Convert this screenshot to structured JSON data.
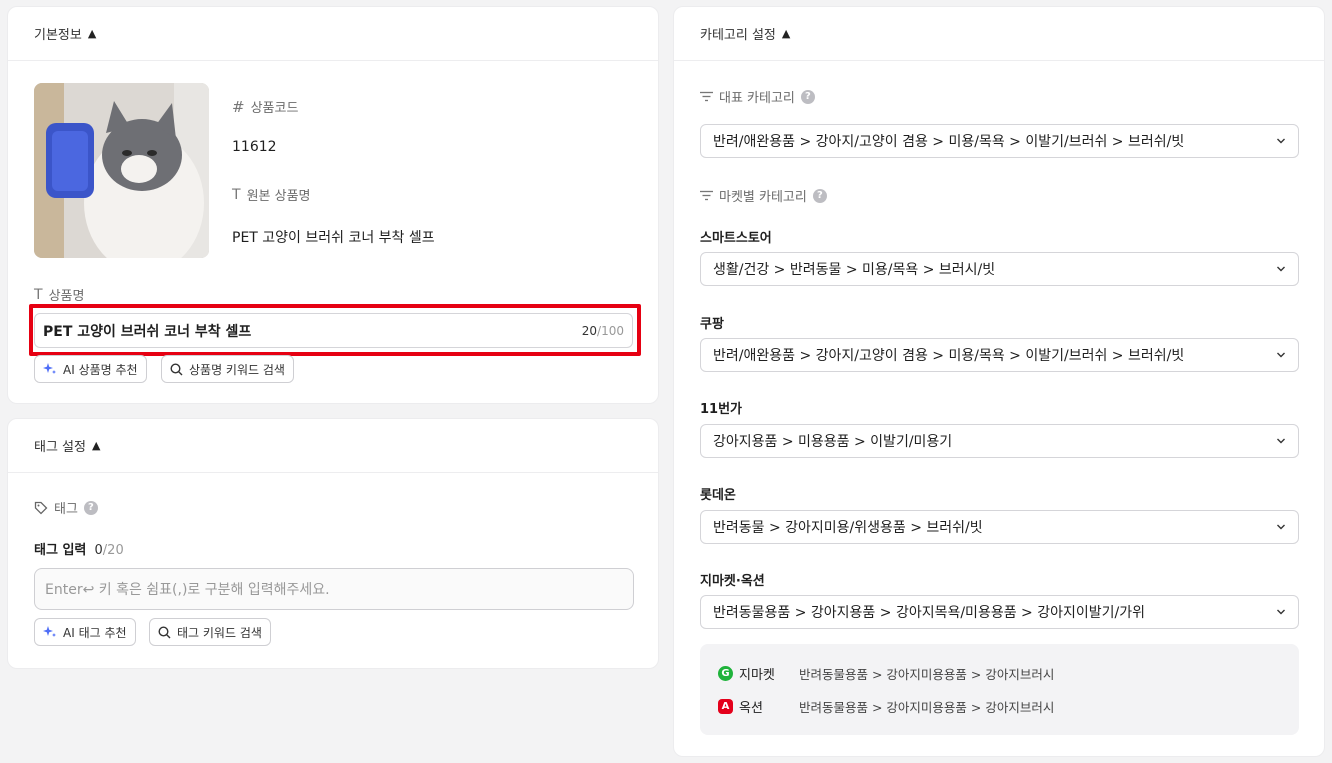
{
  "basic": {
    "title": "기본정보",
    "product_code_label": "상품코드",
    "product_code": "11612",
    "original_name_label": "원본 상품명",
    "original_name": "PET 고양이 브러쉬 코너 부착 셀프",
    "name_label": "상품명",
    "name_value": "PET 고양이 브러쉬 코너 부착 셀프",
    "name_count": "20",
    "name_max": "/100",
    "ai_name_button": "AI 상품명 추천",
    "keyword_search_button": "상품명 키워드 검색"
  },
  "tags": {
    "title": "태그 설정",
    "tag_label": "태그",
    "input_label": "태그 입력",
    "input_count": "0",
    "input_max": "/20",
    "input_placeholder": "Enter↩ 키 혹은 쉼표(,)로 구분해 입력해주세요.",
    "ai_tag_button": "AI 태그 추천",
    "tag_keyword_button": "태그 키워드 검색"
  },
  "category": {
    "title": "카테고리 설정",
    "main_label": "대표 카테고리",
    "main_value": "반려/애완용품 > 강아지/고양이 겸용 > 미용/목욕 > 이발기/브러쉬 > 브러쉬/빗",
    "market_label": "마켓별 카테고리",
    "markets": [
      {
        "name": "스마트스토어",
        "value": "생활/건강 > 반려동물 > 미용/목욕 > 브러시/빗"
      },
      {
        "name": "쿠팡",
        "value": "반려/애완용품 > 강아지/고양이 겸용 > 미용/목욕 > 이발기/브러쉬 > 브러쉬/빗"
      },
      {
        "name": "11번가",
        "value": "강아지용품 > 미용용품 > 이발기/미용기"
      },
      {
        "name": "롯데온",
        "value": "반려동물 > 강아지미용/위생용품 > 브러쉬/빗"
      },
      {
        "name": "지마켓·옥션",
        "value": "반려동물용품 > 강아지용품 > 강아지목욕/미용용품 > 강아지이발기/가위"
      }
    ],
    "sub_markets": [
      {
        "badge": "G",
        "name": "지마켓",
        "path": "반려동물용품 > 강아지미용용품 > 강아지브러시",
        "color": "#1fb33b"
      },
      {
        "badge": "A",
        "name": "옥션",
        "path": "반려동물용품 > 강아지미용용품 > 강아지브러시",
        "color": "#e4001b"
      }
    ]
  },
  "colors": {
    "highlight": "#e60012",
    "ai_sparkle": "#4f6ef7"
  },
  "icons": {
    "hash": "hash-icon",
    "text": "text-icon",
    "tag": "tag-icon",
    "filter": "filter-icon",
    "sparkle": "sparkle-icon",
    "search": "search-icon",
    "chevron": "chevron-down-icon",
    "help": "help-icon"
  }
}
